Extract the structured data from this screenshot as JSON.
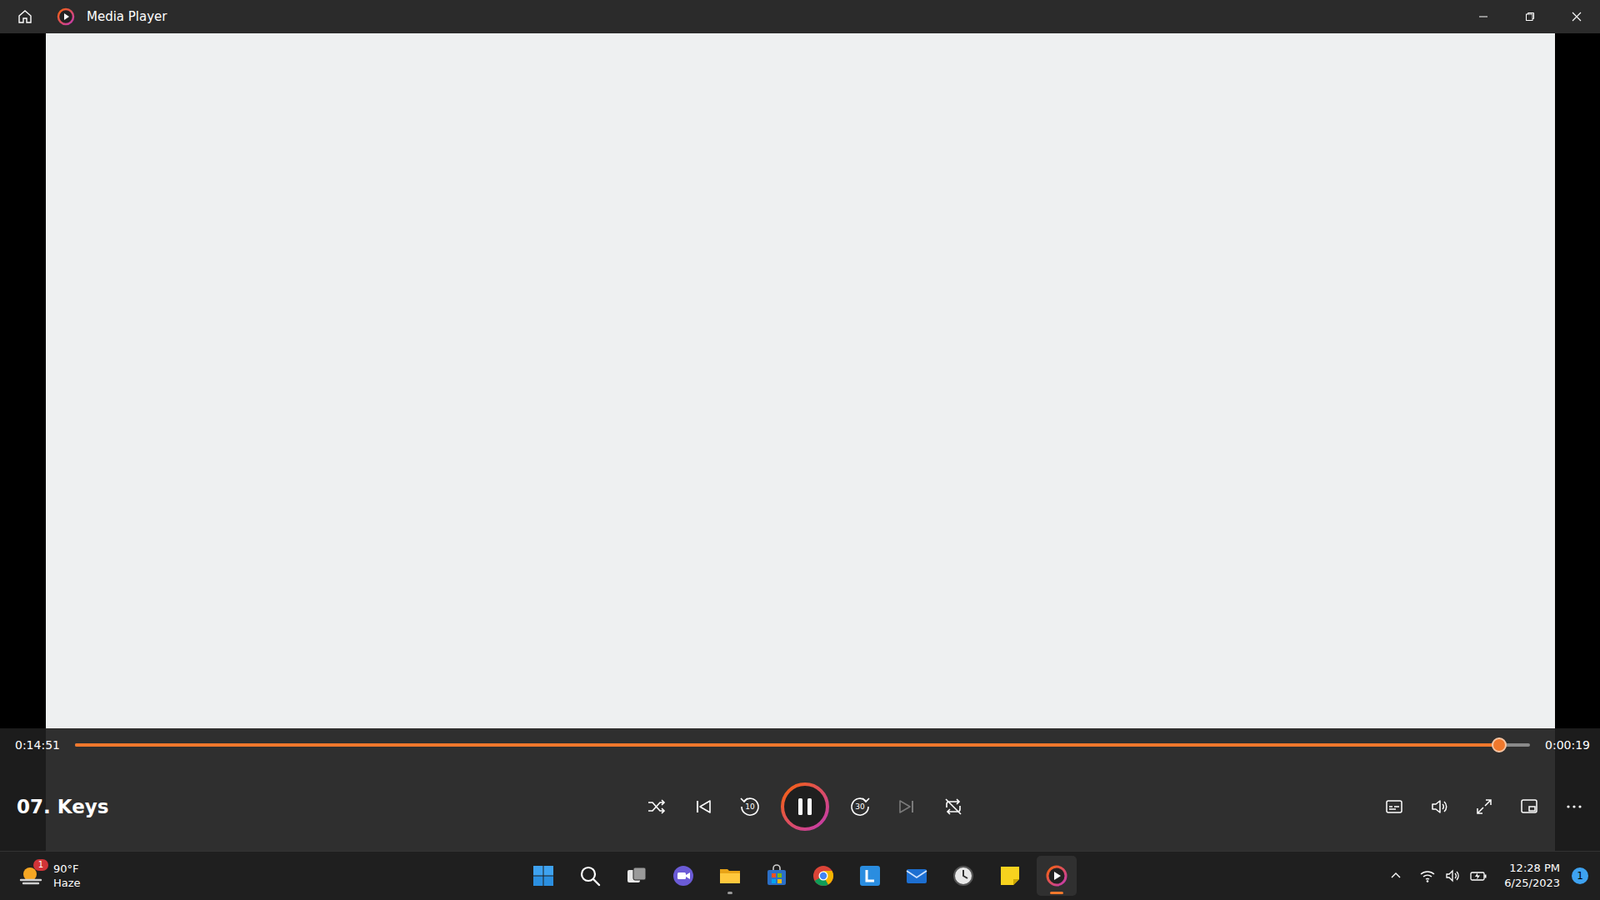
{
  "window": {
    "title": "Media Player"
  },
  "video": {
    "title": "07. Keys",
    "playing": true,
    "elapsed": "0:14:51",
    "remaining": "0:00:19",
    "level": 0.979
  },
  "controls": [
    {
      "kind": "shuffle",
      "on": false,
      "disabled": false,
      "label": ""
    },
    {
      "kind": "previous",
      "on": false,
      "disabled": false,
      "label": ""
    },
    {
      "kind": "rewind",
      "on": false,
      "disabled": false,
      "label": "10"
    },
    {
      "kind": "play",
      "on": true,
      "disabled": false,
      "label": ""
    },
    {
      "kind": "forward",
      "on": false,
      "disabled": false,
      "label": "30"
    },
    {
      "kind": "next",
      "on": false,
      "disabled": true,
      "label": ""
    },
    {
      "kind": "repeat",
      "on": false,
      "disabled": false,
      "label": ""
    }
  ],
  "side_controls": [
    {
      "kind": "subtitles"
    },
    {
      "kind": "volume"
    },
    {
      "kind": "fullscreen"
    },
    {
      "kind": "miniplayer"
    },
    {
      "kind": "more"
    }
  ],
  "taskbar": {
    "weather": {
      "temperature": "90°F",
      "condition": "Haze",
      "badge": "1"
    },
    "apps": [
      {
        "kind": "start",
        "running": false,
        "active": false
      },
      {
        "kind": "search",
        "running": false,
        "active": false
      },
      {
        "kind": "taskview",
        "running": false,
        "active": false
      },
      {
        "kind": "meet",
        "running": false,
        "active": false
      },
      {
        "kind": "explorer",
        "running": true,
        "active": false
      },
      {
        "kind": "store",
        "running": false,
        "active": false
      },
      {
        "kind": "chrome",
        "running": false,
        "active": false
      },
      {
        "kind": "lapp",
        "running": false,
        "active": false
      },
      {
        "kind": "mail",
        "running": false,
        "active": false
      },
      {
        "kind": "clock",
        "running": false,
        "active": false
      },
      {
        "kind": "notes",
        "running": false,
        "active": false
      },
      {
        "kind": "mediaplayer",
        "running": true,
        "active": true
      }
    ],
    "clock": {
      "time": "12:28 PM",
      "date": "6/25/2023"
    },
    "notifications": "1"
  }
}
